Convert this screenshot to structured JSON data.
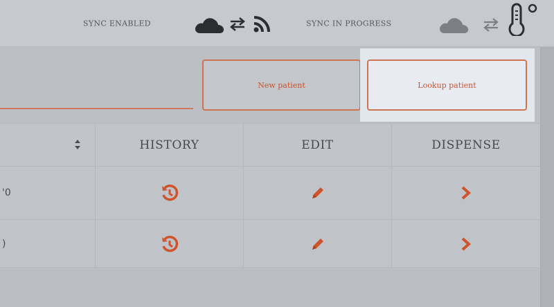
{
  "status_bar": {
    "sync_enabled_label": "SYNC ENABLED",
    "sync_in_progress_label": "SYNC IN PROGRESS",
    "icons": [
      "cloud-icon",
      "sync-arrows-icon",
      "wifi-icon",
      "cloud-icon",
      "sync-arrows-icon",
      "thermometer-icon"
    ]
  },
  "actions": {
    "new_patient_label": "New patient",
    "lookup_patient_label": "Lookup patient"
  },
  "table": {
    "columns": [
      "",
      "HISTORY",
      "EDIT",
      "DISPENSE"
    ],
    "rows": [
      {
        "first_cell": "'0",
        "history_icon": "history-icon",
        "edit_icon": "pencil-icon",
        "dispense_icon": "chevron-right-icon"
      },
      {
        "first_cell": ")",
        "history_icon": "history-icon",
        "edit_icon": "pencil-icon",
        "dispense_icon": "chevron-right-icon"
      }
    ]
  },
  "colors": {
    "accent": "#d0532b",
    "highlight_background": "#e2e7ee",
    "icon_dark": "#2b2d30"
  }
}
